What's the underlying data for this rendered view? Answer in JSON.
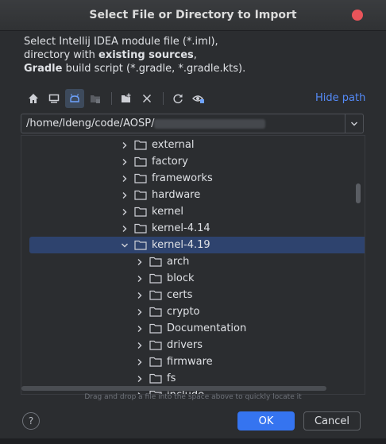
{
  "window": {
    "title": "Select File or Directory to Import"
  },
  "description": {
    "line1": "Select Intellij IDEA module file (*.iml),",
    "line2_prefix": "directory with ",
    "line2_bold": "existing sources",
    "line2_suffix": ",",
    "line3_bold": "Gradle",
    "line3_suffix": " build script (*.gradle, *.gradle.kts)."
  },
  "toolbar": {
    "icons": [
      "home-icon",
      "desktop-icon",
      "android-icon",
      "module-icon",
      "new-folder-icon",
      "delete-icon",
      "refresh-icon",
      "show-hidden-icon"
    ],
    "hide_path_label": "Hide path"
  },
  "path": {
    "value": "/home/ldeng/code/AOSP/"
  },
  "tree": {
    "rows": [
      {
        "label": "external",
        "expanded": false,
        "depth": 0
      },
      {
        "label": "factory",
        "expanded": false,
        "depth": 0
      },
      {
        "label": "frameworks",
        "expanded": false,
        "depth": 0
      },
      {
        "label": "hardware",
        "expanded": false,
        "depth": 0
      },
      {
        "label": "kernel",
        "expanded": false,
        "depth": 0
      },
      {
        "label": "kernel-4.14",
        "expanded": false,
        "depth": 0
      },
      {
        "label": "kernel-4.19",
        "expanded": true,
        "depth": 0,
        "selected": true
      },
      {
        "label": "arch",
        "expanded": false,
        "depth": 1
      },
      {
        "label": "block",
        "expanded": false,
        "depth": 1
      },
      {
        "label": "certs",
        "expanded": false,
        "depth": 1
      },
      {
        "label": "crypto",
        "expanded": false,
        "depth": 1
      },
      {
        "label": "Documentation",
        "expanded": false,
        "depth": 1
      },
      {
        "label": "drivers",
        "expanded": false,
        "depth": 1
      },
      {
        "label": "firmware",
        "expanded": false,
        "depth": 1
      },
      {
        "label": "fs",
        "expanded": false,
        "depth": 1
      },
      {
        "label": "include",
        "expanded": false,
        "depth": 1
      }
    ]
  },
  "hint": "Drag and drop a file into the space above to quickly locate it",
  "buttons": {
    "help": "?",
    "ok": "OK",
    "cancel": "Cancel"
  },
  "colors": {
    "accent": "#3574f0",
    "link": "#548af7",
    "selection": "#2e436e",
    "close": "#e8545a"
  }
}
